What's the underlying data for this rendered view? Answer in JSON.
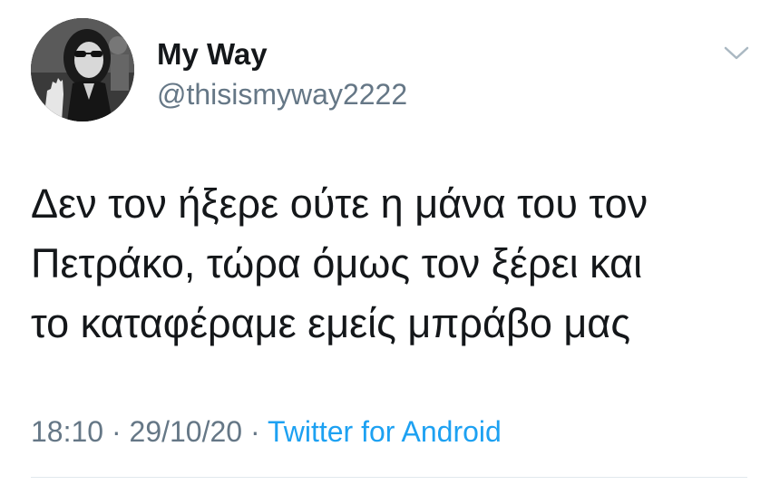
{
  "author": {
    "display_name": "My Way",
    "handle": "@thisismyway2222",
    "avatar_icon": "profile-photo"
  },
  "menu_icon": "chevron-down-icon",
  "tweet": {
    "lines": [
      "Δεν τον ήξερε ούτε η μάνα του τον",
      "Πετράκο, τώρα όμως τον ξέρει και",
      "το καταφέραμε εμείς μπράβο μας"
    ]
  },
  "meta": {
    "time": "18:10",
    "separator": " · ",
    "date": "29/10/20",
    "source": "Twitter for Android"
  },
  "colors": {
    "text": "#14171a",
    "secondary": "#657786",
    "link": "#1da1f2",
    "divider": "#e1e8ed"
  }
}
